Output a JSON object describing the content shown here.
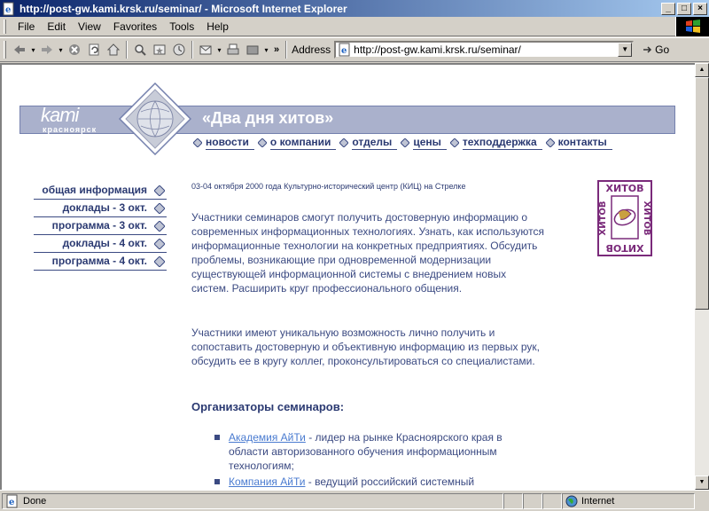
{
  "window": {
    "title": "http://post-gw.kami.krsk.ru/seminar/ - Microsoft Internet Explorer",
    "min_label": "_",
    "max_label": "□",
    "close_label": "×"
  },
  "menu": {
    "items": [
      {
        "label": "File"
      },
      {
        "label": "Edit"
      },
      {
        "label": "View"
      },
      {
        "label": "Favorites"
      },
      {
        "label": "Tools"
      },
      {
        "label": "Help"
      }
    ]
  },
  "toolbar": {
    "address_label": "Address",
    "url": "http://post-gw.kami.krsk.ru/seminar/",
    "go_label": "Go",
    "chevron": "»"
  },
  "site": {
    "logo_word": "kami",
    "logo_city": "красноярск",
    "header_title": "«Два дня хитов»",
    "nav": [
      {
        "label": "новости"
      },
      {
        "label": "о компании"
      },
      {
        "label": "отделы"
      },
      {
        "label": "цены"
      },
      {
        "label": "техподдержка"
      },
      {
        "label": "контакты"
      }
    ],
    "side_nav": [
      {
        "label": "общая информация"
      },
      {
        "label": "доклады - 3 окт."
      },
      {
        "label": "программа - 3 окт."
      },
      {
        "label": "доклады - 4 окт."
      },
      {
        "label": "программа - 4 окт."
      }
    ],
    "date_line": "03-04 октября 2000 года Культурно-исторический центр (КИЦ) на Стрелке",
    "paragraph1": "Участники семинаров смогут получить достоверную информацию о современных информационных технологиях. Узнать, как используются информационные технологии на конкретных предприятиях. Обсудить проблемы, возникающие при одновременной модернизации существующей информационной системы с внедрением новых систем. Расширить круг профессионального общения.",
    "paragraph2": "Участники имеют уникальную возможность лично получить и сопоставить достоверную и объективную информацию из первых рук, обсудить ее в кругу коллег, проконсультироваться со специалистами.",
    "organizers_title": "Организаторы семинаров:",
    "organizers": [
      {
        "link": "Академия АйТи",
        "text": " - лидер на рынке Красноярского края в области авторизованного обучения информационным технологиям;"
      },
      {
        "link": "Компания АйТи",
        "text": " - ведущий российский системный"
      }
    ],
    "hits_logo_text": "ХИТОВ"
  },
  "status": {
    "text": "Done",
    "zone": "Internet"
  },
  "colors": {
    "title_bar": "#0a246a",
    "header_band": "#aab1cc",
    "nav_text": "#2b3a72",
    "body_text": "#3b4a82",
    "link": "#4a7bd0",
    "hits_purple": "#7a2a7a"
  }
}
